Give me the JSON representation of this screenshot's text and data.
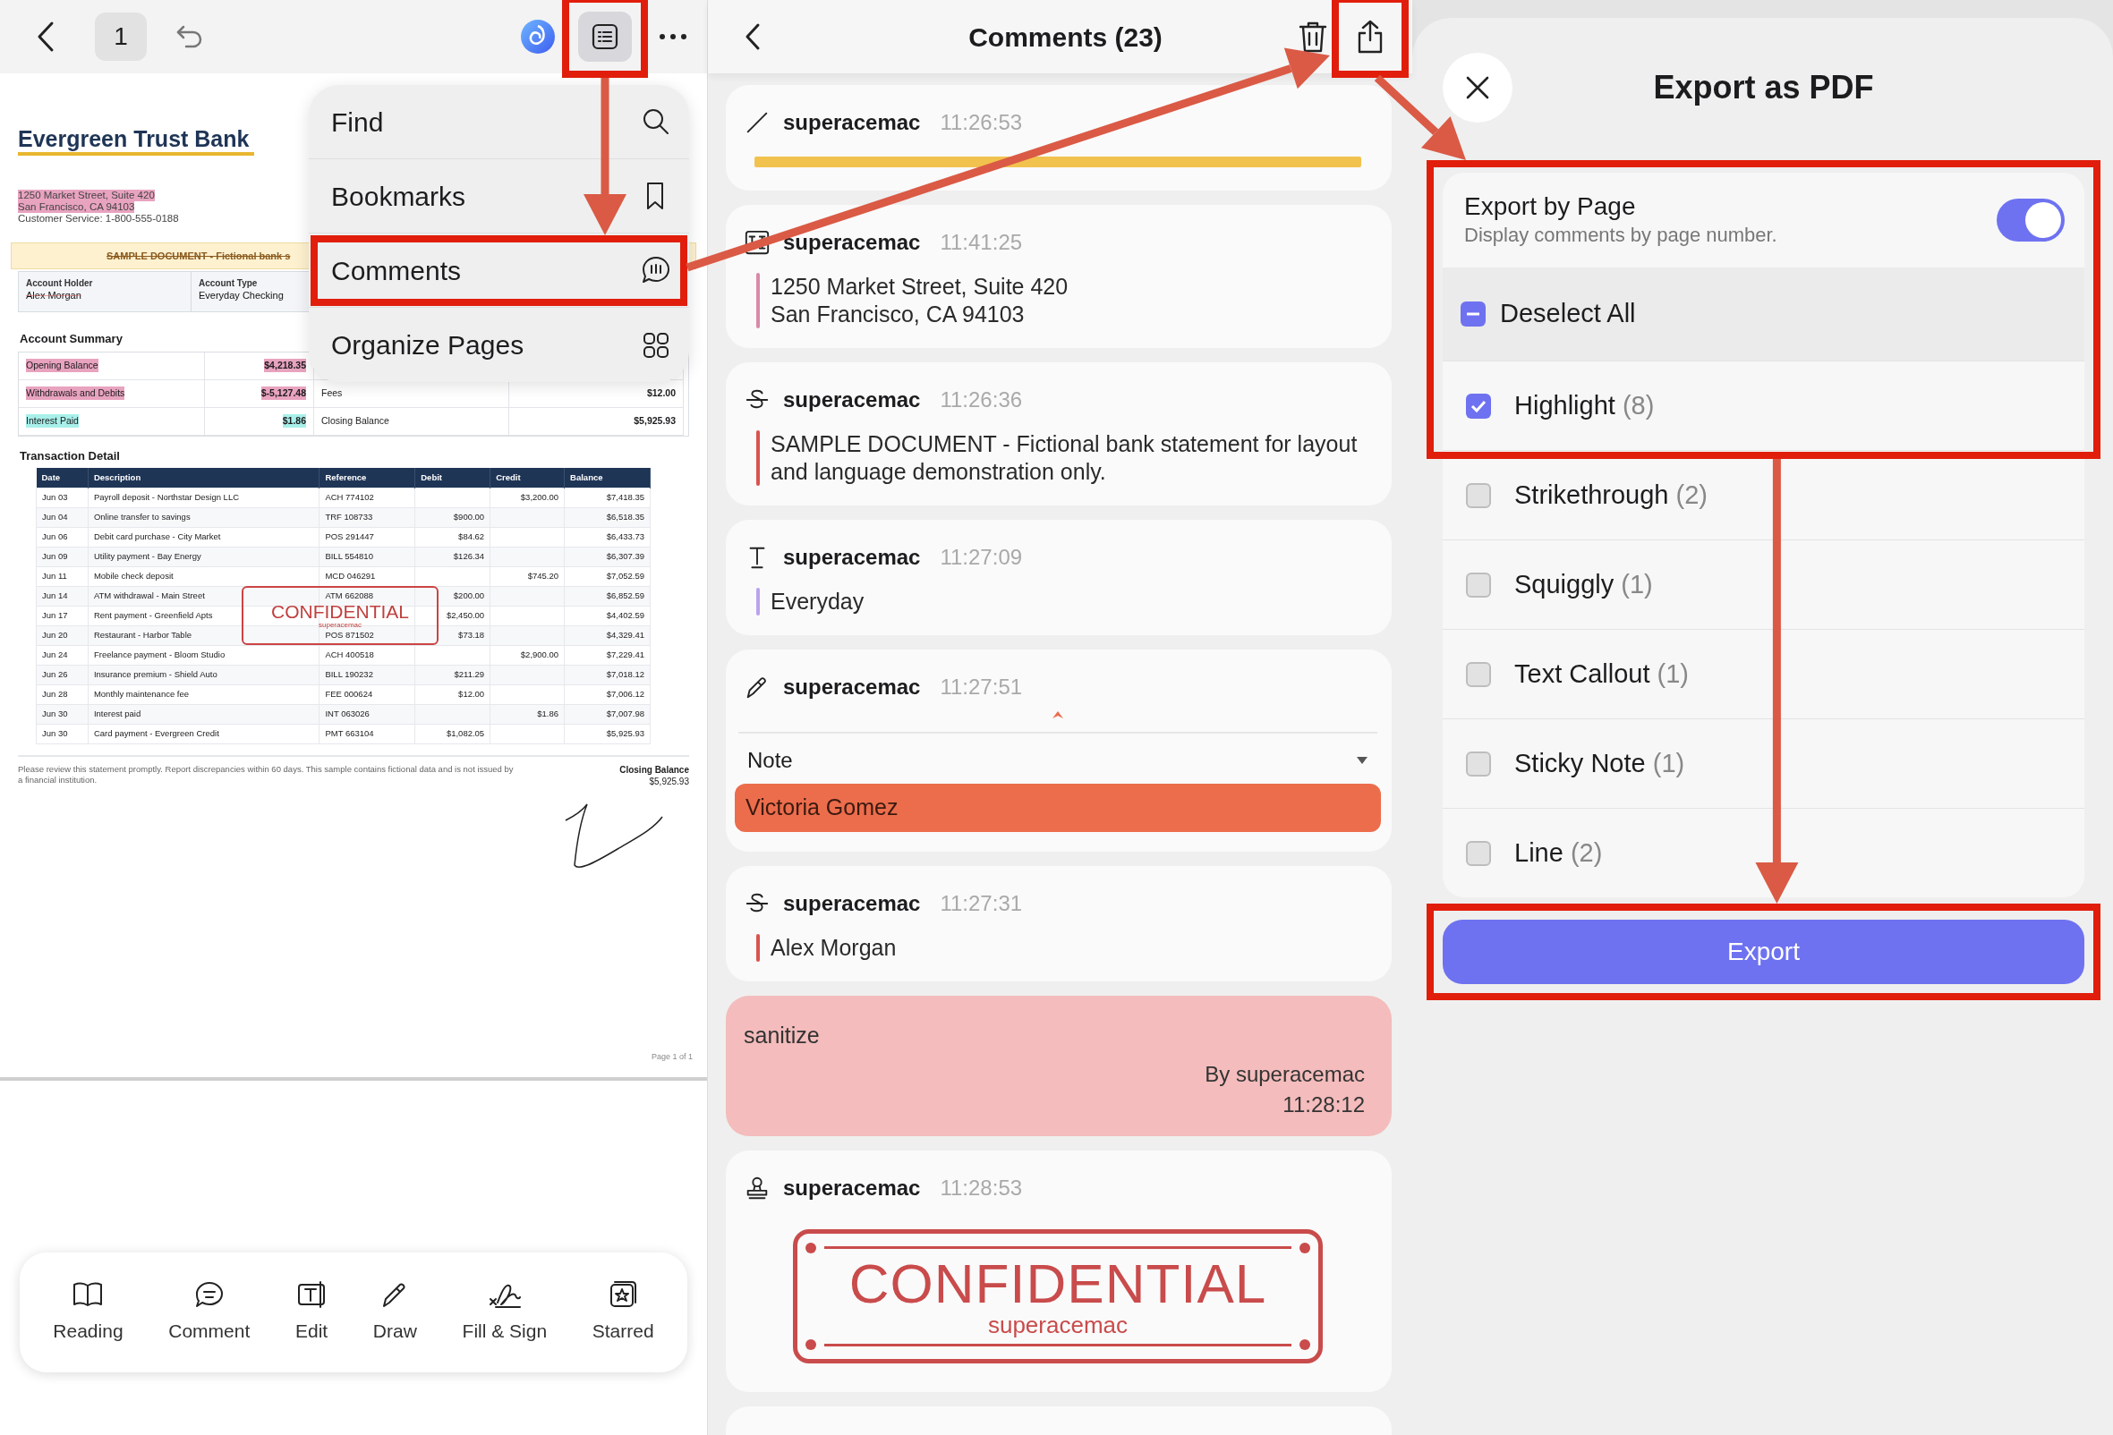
{
  "reader": {
    "page_number": "1",
    "document": {
      "bank_name": "Evergreen Trust Bank",
      "address": [
        {
          "text": "1250 Market Street, Suite 420",
          "color": "#e8a3bf"
        },
        {
          "text": "San Francisco, CA 94103",
          "color": "#e8a3bf"
        },
        {
          "text": "Customer Service: 1-800-555-0188"
        }
      ],
      "banner": {
        "text": "SAMPLE DOCUMENT - Fictional bank s",
        "struck": true
      },
      "account_info": [
        {
          "label": "Account Holder",
          "value": "Alex Morgan",
          "struck": true
        },
        {
          "label": "Account Type",
          "value": "Everyday Checking",
          "struck": false
        }
      ],
      "summary_title": "Account Summary",
      "summary_rows": [
        [
          {
            "text": "Opening Balance",
            "color": "#e8a3bf"
          },
          {
            "text": "$4,218.35",
            "color": "#e8a3bf"
          }
        ],
        [
          {
            "text": "Withdrawals and Debits",
            "color": "#e8a3bf"
          },
          {
            "text": "$-5,127.48",
            "color": "#e8a3bf"
          },
          {
            "text": "Fees"
          },
          {
            "text": "$12.00"
          }
        ],
        [
          {
            "text": "Interest Paid",
            "color": "#a8f0ea"
          },
          {
            "text": "$1.86",
            "color": "#a8f0ea"
          },
          {
            "text": "Closing Balance"
          },
          {
            "text": "$5,925.93"
          }
        ]
      ],
      "transactions_title": "Transaction Detail",
      "columns": [
        "Date",
        "Description",
        "Reference",
        "Debit",
        "Credit",
        "Balance"
      ],
      "rows": [
        [
          "Jun 03",
          "Payroll deposit - Northstar Design LLC",
          "ACH 774102",
          null,
          "$3,200.00",
          "$7,418.35"
        ],
        [
          "Jun 04",
          "Online transfer to savings",
          "TRF 108733",
          "$900.00",
          null,
          "$6,518.35"
        ],
        [
          "Jun 06",
          "Debit card purchase - City Market",
          "POS 291447",
          "$84.62",
          null,
          "$6,433.73"
        ],
        [
          "Jun 09",
          "Utility payment - Bay Energy",
          "BILL 554810",
          "$126.34",
          null,
          "$6,307.39"
        ],
        [
          "Jun 11",
          "Mobile check deposit",
          "MCD 046291",
          null,
          "$745.20",
          "$7,052.59"
        ],
        [
          "Jun 14",
          "ATM withdrawal - Main Street",
          "ATM 662088",
          "$200.00",
          null,
          "$6,852.59"
        ],
        [
          "Jun 17",
          "Rent payment - Greenfield Apts",
          null,
          "$2,450.00",
          null,
          "$4,402.59"
        ],
        [
          "Jun 20",
          "Restaurant - Harbor Table",
          "POS 871502",
          "$73.18",
          null,
          "$4,329.41"
        ],
        [
          "Jun 24",
          "Freelance payment - Bloom Studio",
          "ACH 400518",
          null,
          "$2,900.00",
          "$7,229.41"
        ],
        [
          "Jun 26",
          "Insurance premium - Shield Auto",
          "BILL 190232",
          "$211.29",
          null,
          "$7,018.12"
        ],
        [
          "Jun 28",
          "Monthly maintenance fee",
          "FEE 000624",
          "$12.00",
          null,
          "$7,006.12"
        ],
        [
          "Jun 30",
          "Interest paid",
          "INT 063026",
          null,
          "$1.86",
          "$7,007.98"
        ],
        [
          "Jun 30",
          "Card payment - Evergreen Credit",
          "PMT 663104",
          "$1,082.05",
          null,
          "$5,925.93"
        ]
      ],
      "stamp": {
        "title": "CONFIDENTIAL",
        "author": "superacemac"
      },
      "footer_note": "Please review this statement promptly. Report discrepancies within 60 days. This sample contains fictional data and is not issued by a financial institution.",
      "closing_label": "Closing Balance",
      "closing_value": "$5,925.93",
      "page_label": "Page 1 of 1"
    },
    "menu": [
      {
        "label": "Find",
        "kind": "find"
      },
      {
        "label": "Bookmarks",
        "kind": "bookmarks"
      },
      {
        "label": "Comments",
        "kind": "comments"
      },
      {
        "label": "Organize Pages",
        "kind": "organize"
      }
    ],
    "tools": [
      {
        "label": "Reading",
        "kind": "reading"
      },
      {
        "label": "Comment",
        "kind": "comment"
      },
      {
        "label": "Edit",
        "kind": "edit"
      },
      {
        "label": "Draw",
        "kind": "draw"
      },
      {
        "label": "Fill & Sign",
        "kind": "sign"
      },
      {
        "label": "Starred",
        "kind": "starred"
      }
    ]
  },
  "comments": {
    "title": "Comments (23)",
    "items": [
      {
        "kind": "line",
        "author": "superacemac",
        "time": "11:26:53",
        "color": "#f2c24f"
      },
      {
        "kind": "highlight",
        "author": "superacemac",
        "time": "11:41:25",
        "color": "#d98aa8",
        "text": "1250 Market Street, Suite 420\nSan Francisco, CA 94103"
      },
      {
        "kind": "strikethrough",
        "author": "superacemac",
        "time": "11:26:36",
        "color": "#d9534f",
        "text": "SAMPLE DOCUMENT - Fictional bank statement for layout and language demonstration only."
      },
      {
        "kind": "text",
        "author": "superacemac",
        "time": "11:27:09",
        "color": "#b9a3ec",
        "text": "Everyday"
      },
      {
        "kind": "drawing",
        "author": "superacemac",
        "time": "11:27:51",
        "field_label": "Note",
        "field_value": "Victoria Gomez",
        "color": "#ec6d4c"
      },
      {
        "kind": "strikethrough",
        "author": "superacemac",
        "time": "11:27:31",
        "color": "#d9534f",
        "text": "Alex Morgan"
      },
      {
        "kind": "callout",
        "text": "sanitize",
        "by": "By superacemac",
        "time": "11:28:12",
        "color": "#f4bcbc"
      },
      {
        "kind": "stamp",
        "author": "superacemac",
        "time": "11:28:53",
        "stamp_title": "CONFIDENTIAL",
        "stamp_author": "superacemac"
      }
    ]
  },
  "export": {
    "title": "Export as PDF",
    "by_page": {
      "label": "Export by Page",
      "description": "Display comments by page number.",
      "on": true
    },
    "deselect_all": "Deselect All",
    "types": [
      {
        "label": "Highlight",
        "count": "(8)",
        "checked": true
      },
      {
        "label": "Strikethrough",
        "count": "(2)",
        "checked": false
      },
      {
        "label": "Squiggly",
        "count": "(1)",
        "checked": false
      },
      {
        "label": "Text Callout",
        "count": "(1)",
        "checked": false
      },
      {
        "label": "Sticky Note",
        "count": "(1)",
        "checked": false
      },
      {
        "label": "Line",
        "count": "(2)",
        "checked": false
      }
    ],
    "button": "Export"
  }
}
